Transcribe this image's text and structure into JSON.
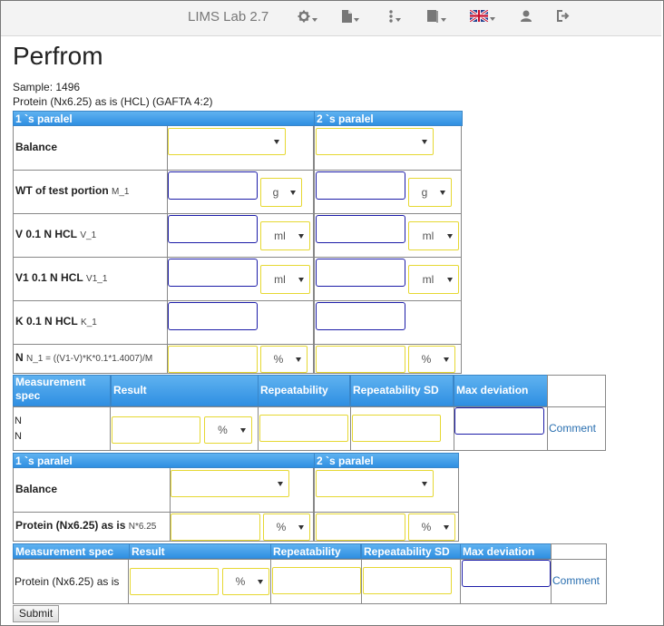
{
  "navbar": {
    "brand": "LIMS Lab 2.7",
    "icons": [
      "gear-icon",
      "file-icon",
      "vertical-dots-icon",
      "book-icon",
      "uk-flag-icon",
      "user-icon",
      "logout-icon"
    ]
  },
  "page": {
    "title": "Perfrom",
    "sample": "Sample: 1496",
    "method": "Protein (Nx6.25) as is (HCL) (GAFTA 4:2)"
  },
  "parallel1": {
    "col1_header": "1 `s paralel",
    "col2_header": "2 `s paralel",
    "rows": [
      {
        "label": "Balance",
        "sub": "",
        "unit1": "",
        "unit2": ""
      },
      {
        "label": "WT of test portion",
        "sub": "M_1",
        "unit1": "g",
        "unit2": "g"
      },
      {
        "label": "V 0.1 N HCL",
        "sub": "V_1",
        "unit1": "ml",
        "unit2": "ml"
      },
      {
        "label": "V1 0.1 N HCL",
        "sub": "V1_1",
        "unit1": "ml",
        "unit2": "ml"
      },
      {
        "label": "K 0.1 N HCL",
        "sub": "K_1",
        "unit1": "",
        "unit2": ""
      },
      {
        "label": "N",
        "sub": "N_1 = ((V1-V)*K*0.1*1.4007)/M",
        "unit1": "%",
        "unit2": "%"
      }
    ]
  },
  "measurement1": {
    "headers": [
      "Measurement spec",
      "Result",
      "Repeatability",
      "Repeatability SD",
      "Max deviation"
    ],
    "spec_line1": "N",
    "spec_line2": "N",
    "unit": "%",
    "comment_link": "Comment"
  },
  "parallel2": {
    "col1_header": "1 `s paralel",
    "col2_header": "2 `s paralel",
    "rows": [
      {
        "label": "Balance",
        "sub": "",
        "unit1": "",
        "unit2": ""
      },
      {
        "label": "Protein (Nx6.25) as is",
        "sub": "N*6.25",
        "unit1": "%",
        "unit2": "%"
      }
    ]
  },
  "measurement2": {
    "headers": [
      "Measurement spec",
      "Result",
      "Repeatability",
      "Repeatability SD",
      "Max deviation"
    ],
    "spec": "Protein (Nx6.25) as is",
    "unit": "%",
    "comment_link": "Comment"
  },
  "submit_label": "Submit"
}
